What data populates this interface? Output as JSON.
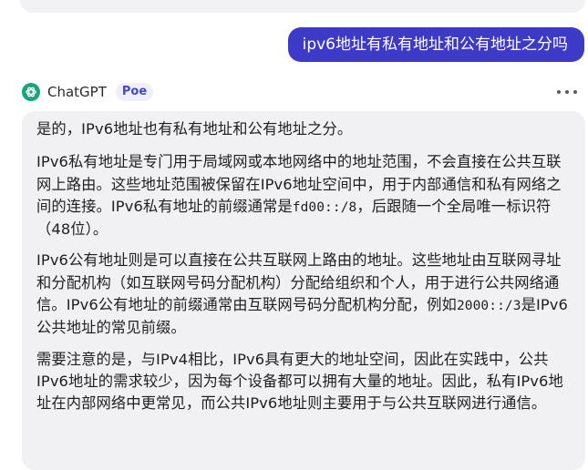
{
  "user_message": "ipv6地址有私有地址和公有地址之分吗",
  "bot": {
    "name": "ChatGPT",
    "badge": "Poe",
    "paragraphs": {
      "p1": "是的，IPv6地址也有私有地址和公有地址之分。",
      "p2a": "IPv6私有地址是专门用于局域网或本地网络中的地址范围，不会直接在公共互联网上路由。这些地址范围被保留在IPv6地址空间中，用于内部通信和私有网络之间的连接。IPv6私有地址的前缀通常是",
      "p2_code": "fd00::/8",
      "p2b": "，后跟随一个全局唯一标识符（48位）。",
      "p3a": "IPv6公有地址则是可以直接在公共互联网上路由的地址。这些地址由互联网寻址和分配机构（如互联网号码分配机构）分配给组织和个人，用于进行公共网络通信。IPv6公有地址的前缀通常由互联网号码分配机构分配，例如",
      "p3_code": "2000::/3",
      "p3b": "是IPv6公共地址的常见前缀。",
      "p4": "需要注意的是，与IPv4相比，IPv6具有更大的地址空间，因此在实践中，公共IPv6地址的需求较少，因为每个设备都可以拥有大量的地址。因此，私有IPv6地址在内部网络中更常见，而公共IPv6地址则主要用于与公共互联网进行通信。"
    }
  },
  "icons": {
    "avatar": "chatgpt-logo-icon",
    "more": "more-horizontal-icon"
  },
  "colors": {
    "user_bubble": "#3d3ac7",
    "bot_bubble": "#f1f1f4",
    "poe_badge_text": "#4646c6",
    "avatar_bg": "#18a57c"
  }
}
